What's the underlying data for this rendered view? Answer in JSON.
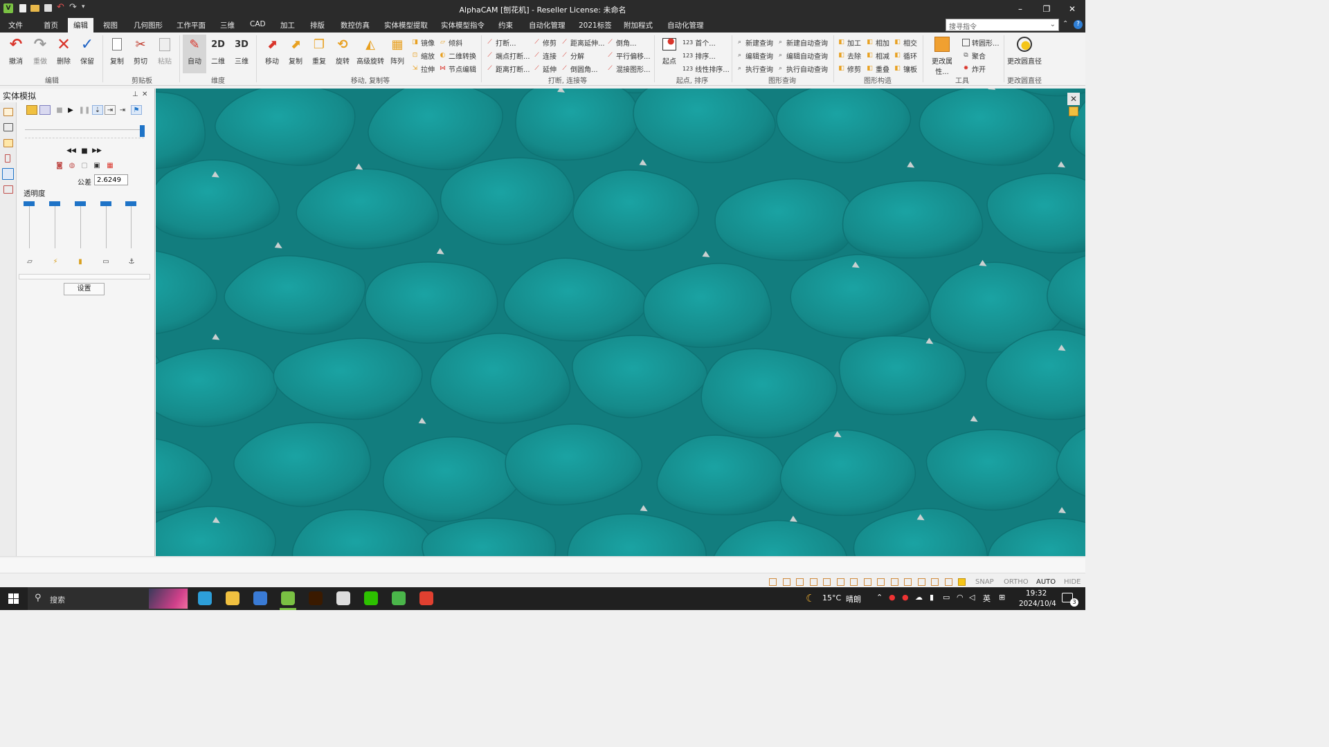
{
  "window": {
    "title": "AlphaCAM [刨花机] - Reseller License: 未命名"
  },
  "titlebar": {
    "minimize": "–",
    "restore": "❐",
    "close": "✕"
  },
  "menu": {
    "items": [
      "文件",
      "首页",
      "编辑",
      "视图",
      "几何图形",
      "工作平面",
      "三维",
      "CAD",
      "加工",
      "排版",
      "数控仿真",
      "实体模型提取",
      "实体模型指令",
      "约束",
      "自动化管理",
      "2021标签",
      "附加程式",
      "自动化管理"
    ],
    "active_index": 2,
    "search_placeholder": "搜寻指令",
    "help": "?"
  },
  "ribbon": {
    "edit_group": {
      "label": "编辑",
      "undo": "撤消",
      "redo": "重做",
      "delete": "删除",
      "keep": "保留"
    },
    "clipboard_group": {
      "label": "剪贴板",
      "copy": "复制",
      "cut": "剪切",
      "paste": "粘贴"
    },
    "dimension_group": {
      "label": "维度",
      "auto": "自动",
      "two_d": "二维",
      "three_d": "三维",
      "two_d_glyph": "2D",
      "three_d_glyph": "3D"
    },
    "move_group": {
      "label": "移动, 复制等",
      "move": "移动",
      "copy": "复制",
      "repeat": "重复",
      "rotate": "旋转",
      "adv_rotate": "高级旋转",
      "array": "阵列",
      "small": [
        "镜像",
        "倾斜",
        "缩放",
        "二维转换",
        "拉伸",
        "节点编辑"
      ]
    },
    "break_group": {
      "label": "打断, 连接等",
      "small": [
        "打断...",
        "修剪",
        "距离延伸...",
        "倒角...",
        "端点打断...",
        "连接",
        "分解",
        "平行偏移...",
        "距离打断...",
        "延伸",
        "倒圆角...",
        "混接图形..."
      ]
    },
    "start_group": {
      "label": "起点, 排序",
      "start": "起点",
      "small": [
        "首个...",
        "排序...",
        "线性排序..."
      ],
      "codes": [
        "123",
        "123",
        "123"
      ]
    },
    "query_group": {
      "label": "图形查询",
      "small": [
        "新建查询",
        "新建自动查询",
        "编辑查询",
        "编辑自动查询",
        "执行查询",
        "执行自动查询"
      ]
    },
    "construct_group": {
      "label": "图形构造",
      "small": [
        "加工",
        "相加",
        "相交",
        "去除",
        "相减",
        "循环",
        "修剪",
        "重叠",
        "镶板"
      ]
    },
    "tools_group": {
      "label": "工具",
      "change_props": "更改属性...",
      "small": [
        "转圆形...",
        "聚合",
        "炸开"
      ]
    },
    "circle_group": {
      "label": "更改圆直径",
      "change_diameter": "更改圆直径"
    }
  },
  "panel": {
    "title": "实体模拟",
    "pin": "ᵖ",
    "close": "✕",
    "tolerance_label": "公差",
    "tolerance_value": "2.6249",
    "transparency_label": "透明度",
    "transparency_levels": [
      1,
      1,
      1,
      1,
      1
    ],
    "settings_button": "设置"
  },
  "statusbar": {
    "flags": [
      "SNAP",
      "ORTHO",
      "AUTO",
      "HIDE"
    ]
  },
  "taskbar": {
    "search": "搜索",
    "weather_temp": "15°C",
    "weather_text": "晴朗",
    "ime": "英",
    "time": "19:32",
    "date": "2024/10/4",
    "notifications": "3"
  },
  "colors": {
    "surface": "#1c8c8c",
    "accent": "#1e73c7",
    "titlebar": "#2b2b2b"
  }
}
